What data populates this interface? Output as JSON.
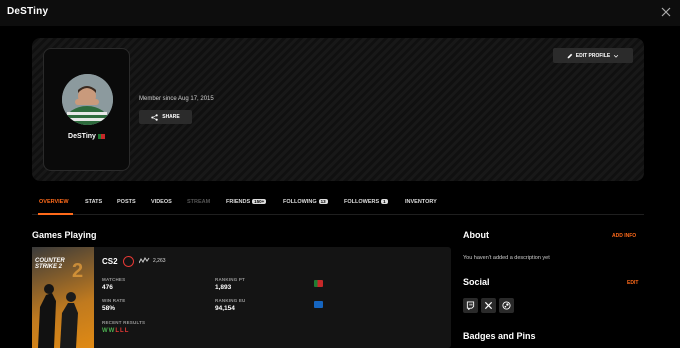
{
  "window": {
    "title": "DeSTiny"
  },
  "banner": {
    "edit_profile_label": "EDIT PROFILE"
  },
  "profile": {
    "username": "DeSTiny",
    "member_since": "Member since Aug 17, 2015",
    "share_label": "SHARE"
  },
  "tabs": [
    {
      "label": "OVERVIEW",
      "active": true
    },
    {
      "label": "STATS"
    },
    {
      "label": "POSTS"
    },
    {
      "label": "VIDEOS"
    },
    {
      "label": "STREAM",
      "disabled": true
    },
    {
      "label": "FRIENDS",
      "count": "150+"
    },
    {
      "label": "FOLLOWING",
      "count": "13"
    },
    {
      "label": "FOLLOWERS",
      "count": "1"
    },
    {
      "label": "INVENTORY"
    }
  ],
  "games_playing": {
    "title": "Games Playing",
    "game": {
      "cover_title_line1": "COUNTER",
      "cover_title_line2": "STRIKE 2",
      "name": "CS2",
      "rating": "2,263",
      "matches_label": "MATCHES",
      "matches_value": "476",
      "ranking_pt_label": "RANKING PT",
      "ranking_pt_value": "1,893",
      "win_rate_label": "WIN RATE",
      "win_rate_value": "58%",
      "ranking_eu_label": "RANKING EU",
      "ranking_eu_value": "94,154",
      "recent_results_label": "RECENT RESULTS",
      "recent_results": [
        "W",
        "W",
        "L",
        "L",
        "L"
      ]
    }
  },
  "about": {
    "title": "About",
    "add_info_label": "ADD INFO",
    "text": "You haven't added a description yet"
  },
  "social": {
    "title": "Social",
    "edit_label": "EDIT",
    "icons": [
      "twitch-icon",
      "x-icon",
      "steam-icon"
    ]
  },
  "badges": {
    "title": "Badges and Pins"
  },
  "colors": {
    "accent": "#ff6a1a",
    "win": "#4caf50",
    "loss": "#e53935"
  }
}
